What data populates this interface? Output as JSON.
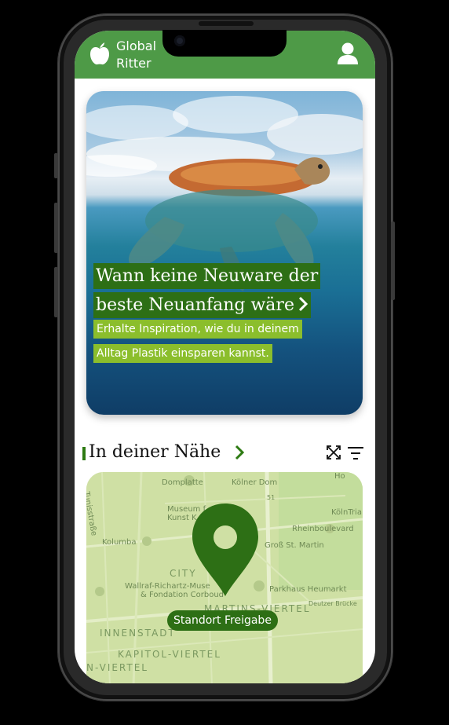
{
  "header": {
    "brand_line1": "Global",
    "brand_line2": "Ritter",
    "logo_icon": "apple-icon",
    "profile_icon": "user-icon",
    "color": "#4e9a47"
  },
  "hero": {
    "title_line1": "Wann keine Neuware der",
    "title_line2": "beste Neuanfang wäre",
    "subtitle_line1": "Erhalte Inspiration, wie du in deinem",
    "subtitle_line2": "Alltag Plastik einsparen kannst.",
    "title_bg": "#2d6f15",
    "subtitle_bg": "#8bbe2c"
  },
  "section": {
    "title": "In deiner Nähe",
    "expand_icon": "expand-icon",
    "filter_icon": "filter-icon"
  },
  "map": {
    "button_label": "Standort Freigabe",
    "labels": {
      "domplatte": "Domplatte",
      "koelner_dom": "Kölner Dom",
      "museum": "Museum f",
      "kunst": "Kunst K",
      "koelntria": "KölnTria",
      "rheinboulevard": "Rheinboulevard",
      "kolumba": "Kolumba",
      "gross_st_martin": "Groß St. Martin",
      "city": "CITY",
      "wallraf1": "Wallraf-Richartz-Muse",
      "wallraf2": "& Fondation Corboud",
      "parkhaus": "Parkhaus Heumarkt",
      "martins": "MARTINS-VIERTEL",
      "deutzer": "Deutzer Brücke",
      "innenstadt": "INNENSTADT",
      "kapitol": "KAPITOL-VIERTEL",
      "viertel": "N-VIERTEL",
      "tunisstr": "Tunisstraße",
      "hohe": "Ho",
      "num51": "51"
    }
  }
}
